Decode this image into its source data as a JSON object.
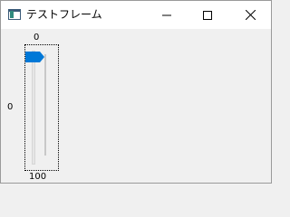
{
  "window": {
    "title": "テストフレーム",
    "icon": "window-app-icon",
    "controls": {
      "minimize_icon": "minimize-icon",
      "maximize_icon": "maximize-icon",
      "close_icon": "close-icon"
    }
  },
  "slider": {
    "orientation": "vertical",
    "min_label": "0",
    "max_label": "100",
    "value_label": "0",
    "value": 0,
    "min": 0,
    "max": 100,
    "thumb_color": "#0078d7"
  }
}
